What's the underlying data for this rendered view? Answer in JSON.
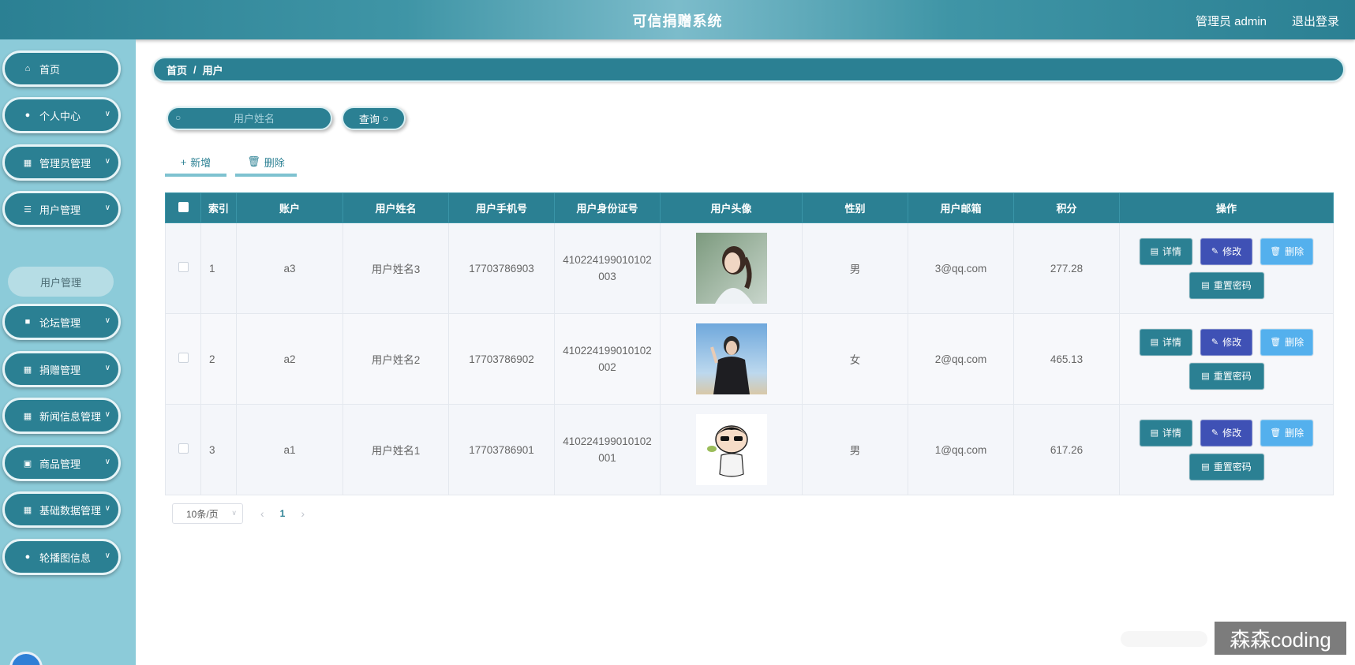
{
  "header": {
    "title": "可信捐赠系统",
    "user": "管理员 admin",
    "logout": "退出登录"
  },
  "sidebar": {
    "items": [
      {
        "label": "首页",
        "icon": "home-icon"
      },
      {
        "label": "个人中心",
        "icon": "user-icon"
      },
      {
        "label": "管理员管理",
        "icon": "grid-icon"
      },
      {
        "label": "用户管理",
        "icon": "list-icon"
      },
      {
        "label": "论坛管理",
        "icon": "chat-icon"
      },
      {
        "label": "捐赠管理",
        "icon": "grid-icon"
      },
      {
        "label": "新闻信息管理",
        "icon": "grid-icon"
      },
      {
        "label": "商品管理",
        "icon": "clipboard-icon"
      },
      {
        "label": "基础数据管理",
        "icon": "grid-icon"
      },
      {
        "label": "轮播图信息",
        "icon": "user-icon"
      }
    ],
    "sub_item": "用户管理"
  },
  "breadcrumb": {
    "home": "首页",
    "sep": "/",
    "current": "用户"
  },
  "search": {
    "placeholder": "用户姓名",
    "button": "查询"
  },
  "toolbar": {
    "add": "新增",
    "delete": "删除"
  },
  "table": {
    "headers": [
      "索引",
      "账户",
      "用户姓名",
      "用户手机号",
      "用户身份证号",
      "用户头像",
      "性别",
      "用户邮箱",
      "积分",
      "操作"
    ],
    "rows": [
      {
        "index": "1",
        "account": "a3",
        "name": "用户姓名3",
        "phone": "17703786903",
        "idcard": "410224199010102003",
        "gender": "男",
        "email": "3@qq.com",
        "points": "277.28"
      },
      {
        "index": "2",
        "account": "a2",
        "name": "用户姓名2",
        "phone": "17703786902",
        "idcard": "410224199010102002",
        "gender": "女",
        "email": "2@qq.com",
        "points": "465.13"
      },
      {
        "index": "3",
        "account": "a1",
        "name": "用户姓名1",
        "phone": "17703786901",
        "idcard": "410224199010102001",
        "gender": "男",
        "email": "1@qq.com",
        "points": "617.26"
      }
    ],
    "actions": {
      "detail": "详情",
      "edit": "修改",
      "delete": "删除",
      "reset": "重置密码"
    }
  },
  "pagination": {
    "page_size": "10条/页",
    "current_page": "1"
  },
  "watermark": "森森coding",
  "colors": {
    "primary": "#2b8093",
    "sidebar_bg": "#8ccbd9",
    "edit": "#3f51b5",
    "delete": "#54b0ed"
  }
}
